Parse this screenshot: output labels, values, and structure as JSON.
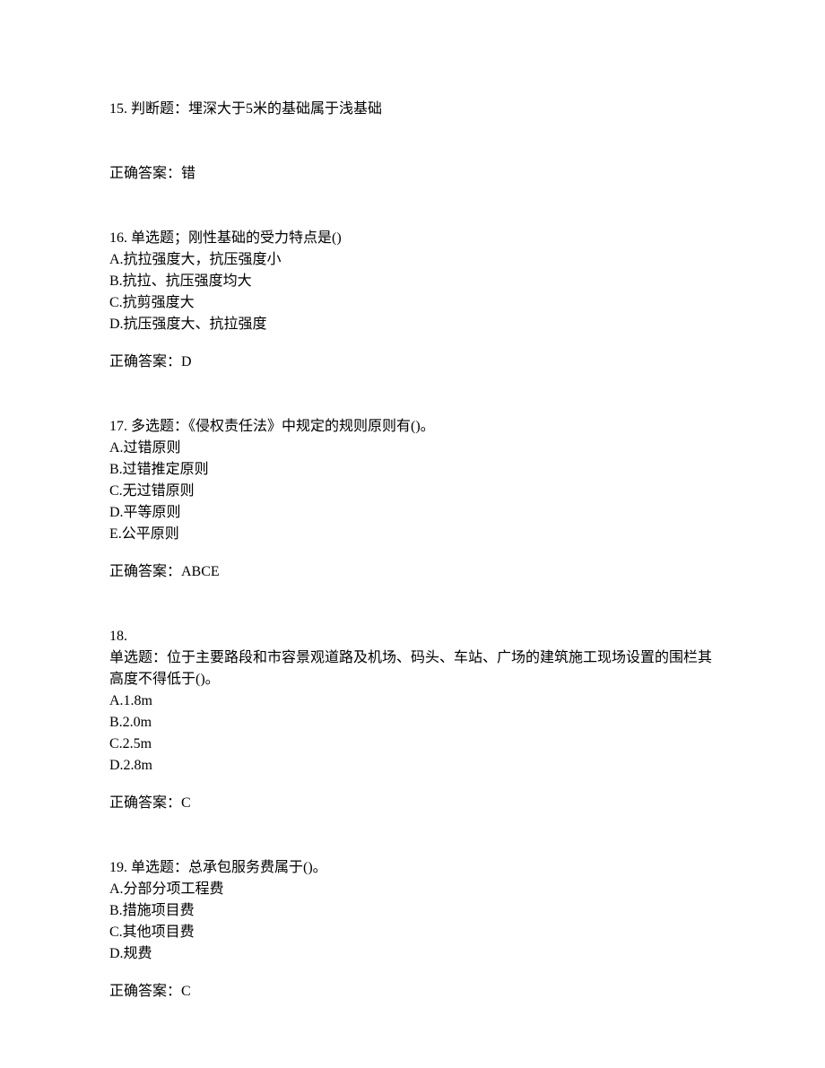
{
  "q15": {
    "prompt": "15. 判断题：埋深大于5米的基础属于浅基础",
    "answer": "正确答案：错"
  },
  "q16": {
    "prompt": "16. 单选题；刚性基础的受力特点是()",
    "a": "A.抗拉强度大，抗压强度小",
    "b": "B.抗拉、抗压强度均大",
    "c": "C.抗剪强度大",
    "d": "D.抗压强度大、抗拉强度",
    "answer": "正确答案：D"
  },
  "q17": {
    "prompt": "17. 多选题：《侵权责任法》中规定的规则原则有()。",
    "a": "A.过错原则",
    "b": "B.过错推定原则",
    "c": "C.无过错原则",
    "d": "D.平等原则",
    "e": "E.公平原则",
    "answer": "正确答案：ABCE"
  },
  "q18": {
    "num": "18.",
    "prompt": "单选题：位于主要路段和市容景观道路及机场、码头、车站、广场的建筑施工现场设置的围栏其高度不得低于()。",
    "a": "A.1.8m",
    "b": "B.2.0m",
    "c": "C.2.5m",
    "d": "D.2.8m",
    "answer": "正确答案：C"
  },
  "q19": {
    "prompt": "19. 单选题：总承包服务费属于()。",
    "a": "A.分部分项工程费",
    "b": "B.措施项目费",
    "c": "C.其他项目费",
    "d": "D.规费",
    "answer": "正确答案：C"
  }
}
